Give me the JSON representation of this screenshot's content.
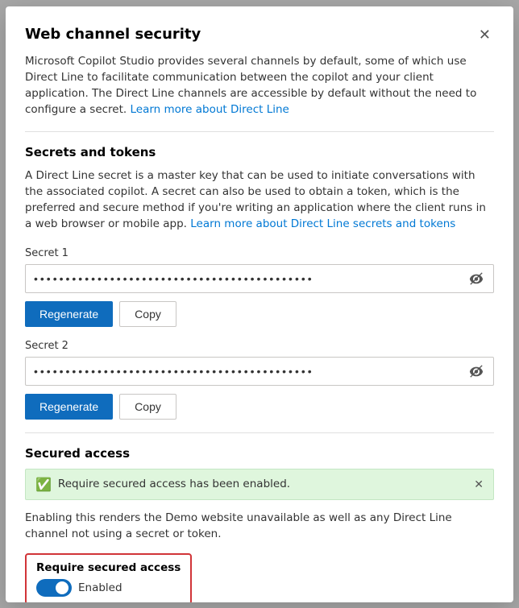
{
  "modal": {
    "title": "Web channel security",
    "close_label": "✕",
    "description": "Microsoft Copilot Studio provides several channels by default, some of which use Direct Line to facilitate communication between the copilot and your client application. The Direct Line channels are accessible by default without the need to configure a secret.",
    "learn_more_link_text": "Learn more about Direct Line",
    "secrets_section": {
      "title": "Secrets and tokens",
      "description": "A Direct Line secret is a master key that can be used to initiate conversations with the associated copilot. A secret can also be used to obtain a token, which is the preferred and secure method if you're writing an application where the client runs in a web browser or mobile app.",
      "learn_more_tokens_text": "Learn more about Direct Line secrets and tokens",
      "secret1": {
        "label": "Secret 1",
        "placeholder": "••••••••••••••••••••••••••••••••••••••••••••",
        "regenerate_label": "Regenerate",
        "copy_label": "Copy",
        "eye_icon": "👁"
      },
      "secret2": {
        "label": "Secret 2",
        "placeholder": "••••••••••••••••••••••••••••••••••••••••••••",
        "regenerate_label": "Regenerate",
        "copy_label": "Copy",
        "eye_icon": "👁"
      }
    },
    "secured_access": {
      "title": "Secured access",
      "banner_text": "Require secured access has been enabled.",
      "warning_text": "Enabling this renders the Demo website unavailable as well as any Direct Line channel not using a secret or token.",
      "toggle_label": "Require secured access",
      "toggle_state": "Enabled",
      "toggle_checked": true
    }
  }
}
